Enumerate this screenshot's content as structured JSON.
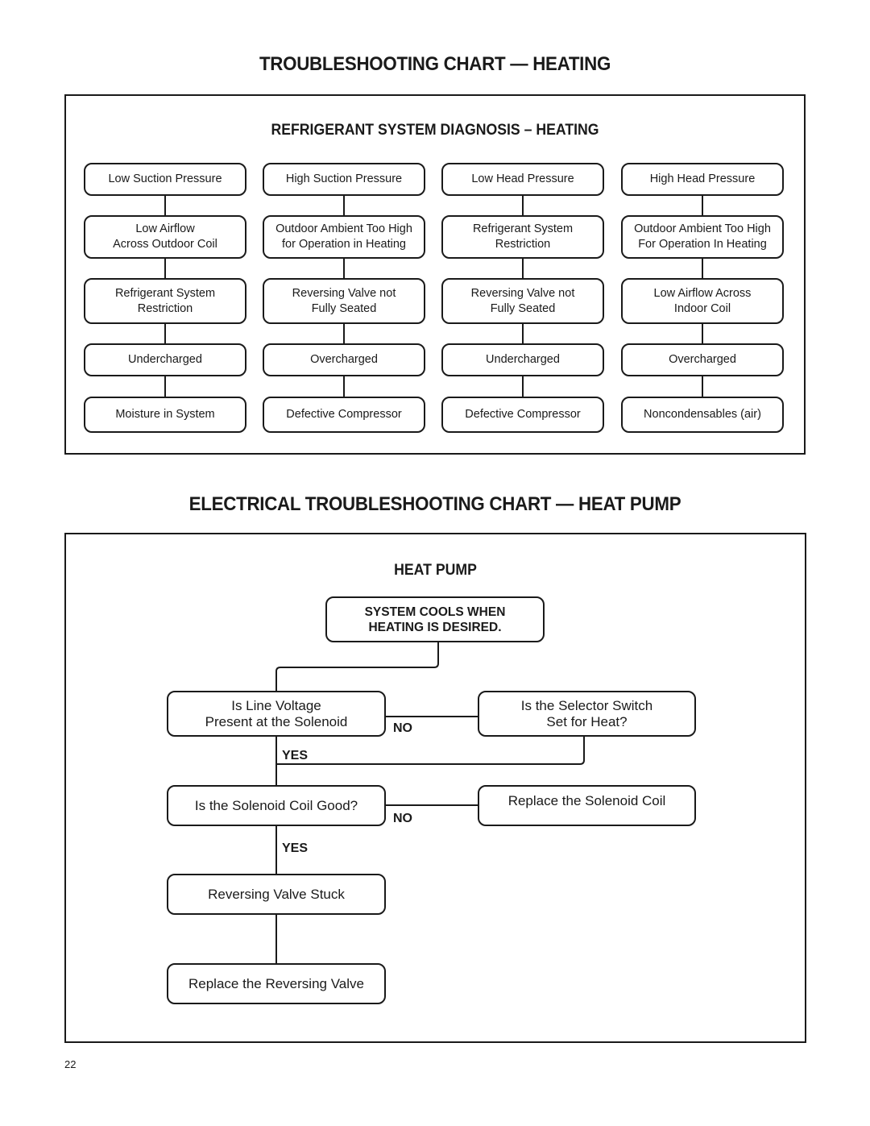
{
  "page": {
    "title_1": "TROUBLESHOOTING CHART — HEATING",
    "title_2": "ELECTRICAL TROUBLESHOOTING CHART — HEAT PUMP",
    "page_number": "22"
  },
  "refrigerant_chart": {
    "heading": "REFRIGERANT  SYSTEM DIAGNOSIS – HEATING",
    "columns": [
      {
        "header": "Low Suction Pressure",
        "causes": [
          "Low Airflow\nAcross Outdoor Coil",
          "Refrigerant System\nRestriction",
          "Undercharged",
          "Moisture in System"
        ]
      },
      {
        "header": "High Suction Pressure",
        "causes": [
          "Outdoor Ambient Too High\nfor Operation in Heating",
          "Reversing Valve not\nFully Seated",
          "Overcharged",
          "Defective Compressor"
        ]
      },
      {
        "header": "Low Head Pressure",
        "causes": [
          "Refrigerant System\nRestriction",
          "Reversing Valve not\nFully Seated",
          "Undercharged",
          "Defective Compressor"
        ]
      },
      {
        "header": "High Head Pressure",
        "causes": [
          "Outdoor Ambient Too High\nFor Operation In Heating",
          "Low Airflow Across\nIndoor Coil",
          "Overcharged",
          "Noncondensables (air)"
        ]
      }
    ]
  },
  "heat_pump_chart": {
    "heading": "HEAT  PUMP",
    "start": "SYSTEM COOLS WHEN\nHEATING IS DESIRED.",
    "q_line_voltage": "Is Line Voltage\nPresent at the Solenoid",
    "q_selector_switch": "Is the Selector Switch\nSet for Heat?",
    "q_solenoid_coil": "Is the Solenoid Coil Good?",
    "a_replace_coil": "Replace the Solenoid Coil",
    "a_valve_stuck": "Reversing Valve Stuck",
    "a_replace_valve": "Replace the Reversing Valve",
    "labels": {
      "no_1": "NO",
      "yes_1": "YES",
      "no_2": "NO",
      "yes_2": "YES"
    }
  }
}
